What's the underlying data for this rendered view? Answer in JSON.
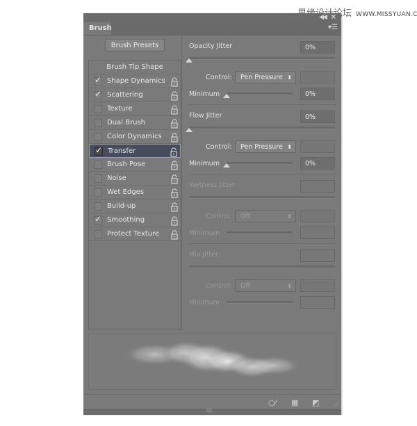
{
  "watermark": {
    "cn": "思缘设计论坛",
    "url": "WWW.MISSYUAN.COM"
  },
  "panel": {
    "tab_label": "Brush",
    "collapse_icon": "double-chevron-left-icon",
    "close_icon": "close-icon",
    "menu_icon": "panel-menu-icon",
    "presets_button": "Brush Presets"
  },
  "left_list": {
    "header": "Brush Tip Shape",
    "items": [
      {
        "label": "Shape Dynamics",
        "checked": true,
        "selected": false
      },
      {
        "label": "Scattering",
        "checked": true,
        "selected": false
      },
      {
        "label": "Texture",
        "checked": false,
        "selected": false
      },
      {
        "label": "Dual Brush",
        "checked": false,
        "selected": false
      },
      {
        "label": "Color Dynamics",
        "checked": false,
        "selected": false
      },
      {
        "label": "Transfer",
        "checked": true,
        "selected": true
      },
      {
        "label": "Brush Pose",
        "checked": false,
        "selected": false
      },
      {
        "label": "Noise",
        "checked": false,
        "selected": false
      },
      {
        "label": "Wet Edges",
        "checked": false,
        "selected": false
      },
      {
        "label": "Build-up",
        "checked": false,
        "selected": false
      },
      {
        "label": "Smoothing",
        "checked": true,
        "selected": false
      },
      {
        "label": "Protect Texture",
        "checked": false,
        "selected": false
      }
    ]
  },
  "right": {
    "opacity": {
      "label": "Opacity Jitter",
      "value": "0%",
      "control_label": "Control:",
      "control": "Pen Pressure",
      "min_label": "Minimum",
      "min_value": "0%",
      "slider_pct": 0,
      "min_slider_pct": 0
    },
    "flow": {
      "label": "Flow Jitter",
      "value": "0%",
      "control_label": "Control:",
      "control": "Pen Pressure",
      "min_label": "Minimum",
      "min_value": "0%",
      "slider_pct": 0,
      "min_slider_pct": 0
    },
    "wetness": {
      "label": "Wetness Jitter",
      "value": "",
      "control_label": "Control:",
      "control": "Off",
      "min_label": "Minimum",
      "min_value": ""
    },
    "mix": {
      "label": "Mix Jitter",
      "value": "",
      "control_label": "Control:",
      "control": "Off",
      "min_label": "Minimum",
      "min_value": ""
    }
  },
  "footer": {
    "icons": [
      "toggle-live-tip-preview-icon",
      "open-preset-manager-icon",
      "create-new-brush-icon"
    ]
  }
}
